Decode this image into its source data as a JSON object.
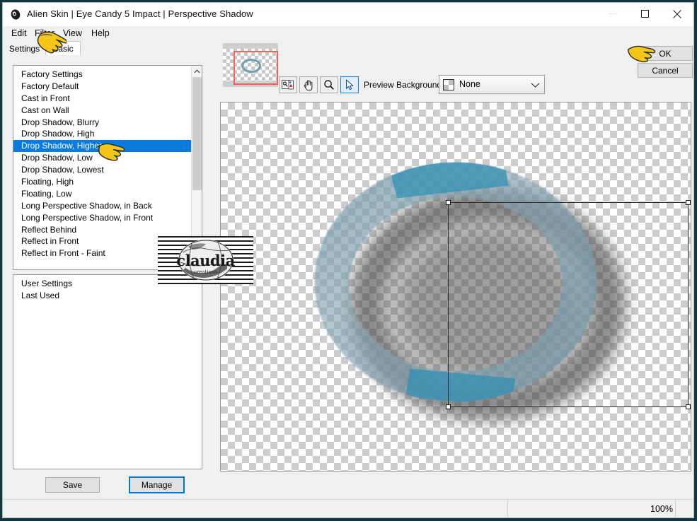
{
  "window": {
    "title": "Alien Skin | Eye Candy 5 Impact | Perspective Shadow",
    "icon": "alien-head-icon",
    "controls": {
      "minimize": "minimize-icon",
      "maximize": "maximize-icon",
      "close": "close-icon"
    }
  },
  "menubar": {
    "items": [
      {
        "label": "Edit"
      },
      {
        "label": "Filter"
      },
      {
        "label": "View"
      },
      {
        "label": "Help"
      }
    ]
  },
  "tabs": [
    {
      "label": "Settings",
      "active": true
    },
    {
      "label": "Basic",
      "active": false
    }
  ],
  "settings_panel": {
    "factory_list": {
      "selected": "Drop Shadow, Higher",
      "items": [
        "Factory Settings",
        "Factory Default",
        "Cast in Front",
        "Cast on Wall",
        "Drop Shadow, Blurry",
        "Drop Shadow, High",
        "Drop Shadow, Higher",
        "Drop Shadow, Low",
        "Drop Shadow, Lowest",
        "Floating, High",
        "Floating, Low",
        "Long Perspective Shadow, in Back",
        "Long Perspective Shadow, in Front",
        "Reflect Behind",
        "Reflect in Front",
        "Reflect in Front - Faint"
      ]
    },
    "user_list": {
      "items": [
        "User Settings",
        "Last Used"
      ]
    },
    "buttons": {
      "save": "Save",
      "manage": "Manage"
    }
  },
  "preview_panel": {
    "tools": [
      {
        "name": "preview-toggle-tool",
        "icon": "image-compare-icon",
        "active": false
      },
      {
        "name": "pan-tool",
        "icon": "hand-icon",
        "active": false
      },
      {
        "name": "zoom-tool",
        "icon": "magnifier-icon",
        "active": false
      },
      {
        "name": "select-tool",
        "icon": "arrow-cursor-icon",
        "active": true
      }
    ],
    "background_label": "Preview Background:",
    "background_value": "None",
    "background_swatch": "checker-transparent-swatch",
    "navigator_selection_color": "#f4605c"
  },
  "actions": {
    "ok": "OK",
    "cancel": "Cancel"
  },
  "statusbar": {
    "zoom": "100%"
  },
  "watermark": {
    "text": "claudia",
    "subtext": "creations"
  },
  "colors": {
    "accent": "#0a7bdc",
    "focus_border": "#0078d7",
    "selection_red": "#f4605c",
    "ring_teal": "#3f93b5",
    "window_bg": "#f0f0f0",
    "desktop": "#12353f"
  }
}
